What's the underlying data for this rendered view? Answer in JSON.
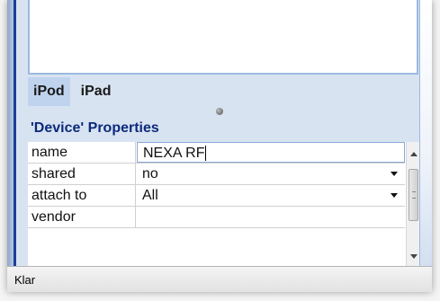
{
  "tabs": [
    {
      "label": "iPod",
      "active": true
    },
    {
      "label": "iPad",
      "active": false
    }
  ],
  "properties": {
    "title": "'Device' Properties",
    "rows": [
      {
        "name": "name",
        "value": "NEXA RF",
        "editing": true
      },
      {
        "name": "shared",
        "value": "no",
        "dropdown": true
      },
      {
        "name": "attach to",
        "value": "All",
        "dropdown": true
      },
      {
        "name": "vendor",
        "value": ""
      }
    ]
  },
  "status": {
    "text": "Klar"
  },
  "colors": {
    "accent": "#0b2a7a",
    "panel_bg": "#d8e3f2",
    "tab_active_bg": "#c0d3ee",
    "frame_blue": "#1b3e96"
  }
}
